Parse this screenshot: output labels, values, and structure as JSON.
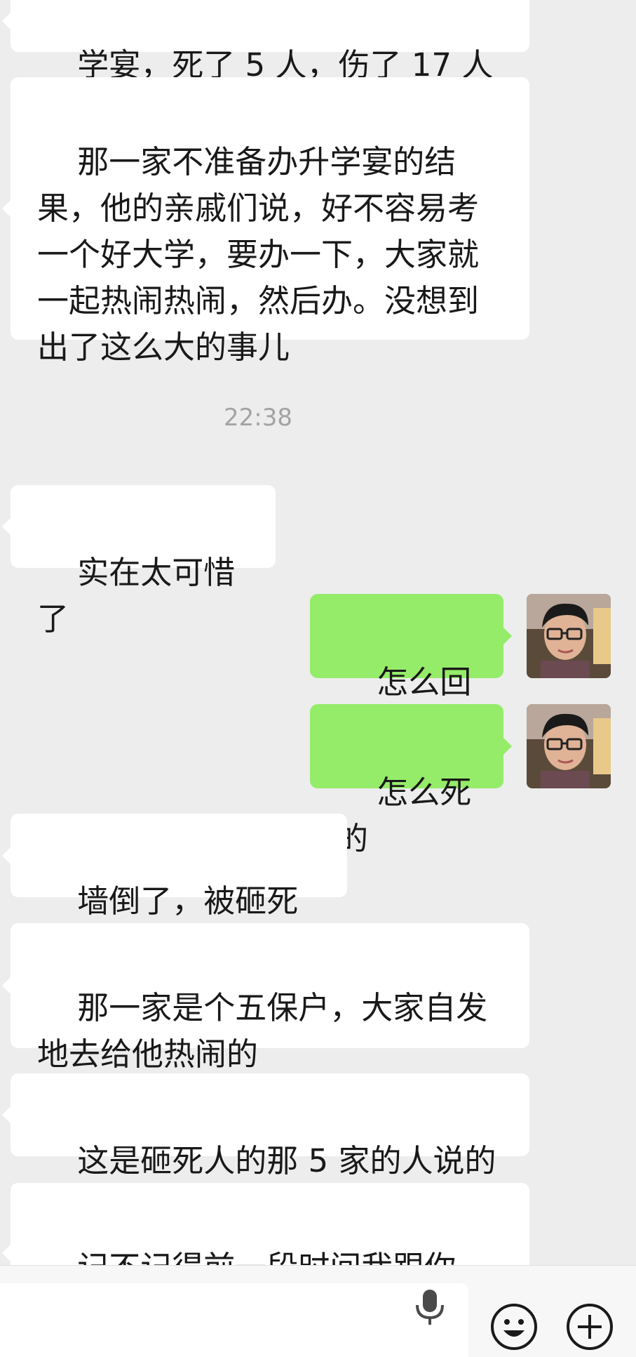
{
  "messages": [
    {
      "side": "in",
      "text": "学宴，死了 5 人，伤了 17 人"
    },
    {
      "side": "in",
      "text": "那一家不准备办升学宴的结果，他的亲戚们说，好不容易考一个好大学，要办一下，大家就一起热闹热闹，然后办。没想到出了这么大的事儿"
    },
    {
      "timestamp": "22:38"
    },
    {
      "side": "in",
      "text": "实在太可惜了"
    },
    {
      "side": "out",
      "text": "怎么回事"
    },
    {
      "side": "out",
      "text": "怎么死的"
    },
    {
      "side": "in",
      "text": "墙倒了，被砸死了"
    },
    {
      "side": "in",
      "text": "那一家是个五保户，大家自发地去给他热闹的"
    },
    {
      "side": "in",
      "text": "这是砸死人的那 5 家的人说的"
    },
    {
      "side": "in",
      "text": "记不记得前一段时间我跟你说，家里进了一个蟑螂，就在你住"
    }
  ],
  "bottom_bar": {
    "voice_icon": "microphone-icon",
    "emoji_icon": "smiley-icon",
    "more_icon": "plus-circle-icon"
  },
  "colors": {
    "background": "#ededed",
    "incoming_bubble": "#ffffff",
    "outgoing_bubble": "#95ec69",
    "text": "#191919",
    "timestamp": "#a3a3a3"
  }
}
